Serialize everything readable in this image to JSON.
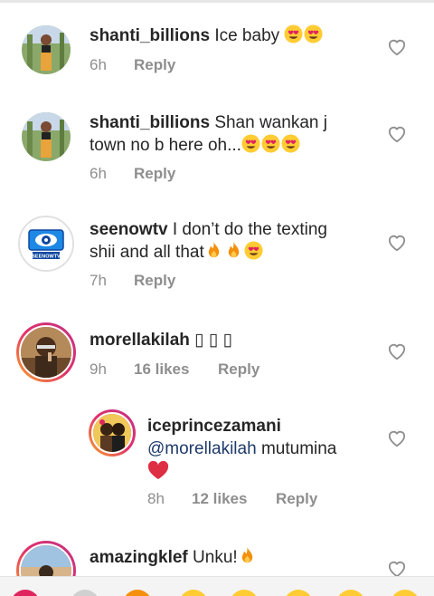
{
  "comments": [
    {
      "username": "shanti_billions",
      "text_line1": "Ice baby",
      "text_line2": "",
      "time": "6h",
      "likes": "",
      "reply": "Reply",
      "emojis": [
        "heart-eyes",
        "heart-eyes"
      ]
    },
    {
      "username": "shanti_billions",
      "text_line1": "Shan wankan j",
      "text_line2": "town no b here oh...",
      "time": "6h",
      "likes": "",
      "reply": "Reply",
      "emojis": [
        "heart-eyes",
        "heart-eyes",
        "heart-eyes"
      ]
    },
    {
      "username": "seenowtv",
      "text_line1": "I don’t do the texting",
      "text_line2": "shii and all that",
      "time": "7h",
      "likes": "",
      "reply": "Reply",
      "emojis": [
        "fire",
        "fire",
        "heart-eyes"
      ]
    },
    {
      "username": "morellakilah",
      "text_line1": "▯ ▯ ▯",
      "text_line2": "",
      "time": "9h",
      "likes": "16 likes",
      "reply": "Reply",
      "emojis": []
    },
    {
      "username": "iceprincezamani",
      "text_line1": "",
      "mention": "@morellakilah",
      "text_after_mention": "mutumina",
      "time": "8h",
      "likes": "12 likes",
      "reply": "Reply",
      "emojis": [
        "red-heart"
      ]
    },
    {
      "username": "amazingklef",
      "text_line1": "Unku!",
      "text_line2": "",
      "time": "",
      "likes": "",
      "reply": "",
      "emojis": [
        "fire"
      ]
    }
  ],
  "avatar_text": {
    "seenowtv": "SEENOWTV"
  },
  "colors": {
    "mention": "#1e3a6b",
    "meta": "#8e8e8e",
    "heart_red": "#e0245e",
    "fire": "#f4900c"
  }
}
